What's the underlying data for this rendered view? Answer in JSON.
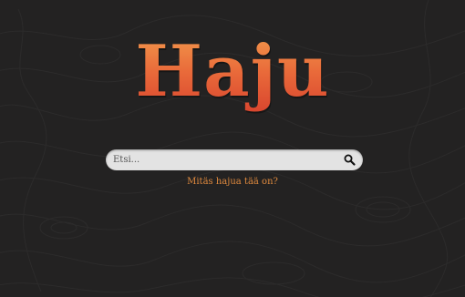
{
  "brand": {
    "logo_text": "Haju"
  },
  "search": {
    "placeholder": "Etsi...",
    "value": "",
    "icon": "search-icon"
  },
  "tagline": {
    "text": "Mitäs hajua tää on?"
  },
  "colors": {
    "background": "#232222",
    "logo_top": "#f39a4c",
    "logo_bottom": "#d9452e",
    "search_bg": "#e3e3e3",
    "accent": "#e08a3e"
  }
}
